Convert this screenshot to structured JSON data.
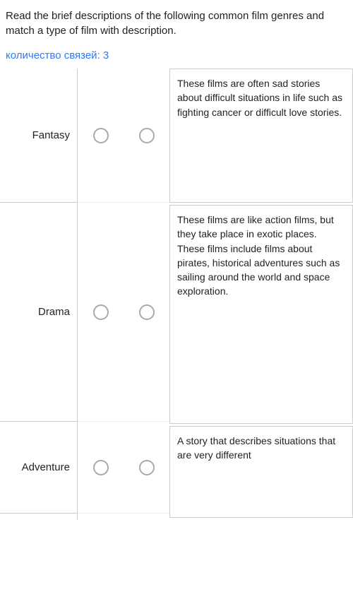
{
  "instructions": {
    "text": "Read the brief descriptions of the following common film genres and match a type of film with description."
  },
  "connections": {
    "label": "количество связей:",
    "count": "3"
  },
  "genres": [
    {
      "id": "fantasy",
      "label": "Fantasy"
    },
    {
      "id": "drama",
      "label": "Drama"
    },
    {
      "id": "adventure",
      "label": "Adventure"
    }
  ],
  "descriptions": [
    {
      "id": "desc1",
      "text": "These films are often sad stories about difficult situations in life such as fighting cancer or difficult love stories."
    },
    {
      "id": "desc2",
      "text": "These films are like action films, but they take place in exotic places. These films include films about pirates, historical adventures such as sailing around the world and space exploration."
    },
    {
      "id": "desc3",
      "text": "A story that describes situations that are very different"
    }
  ],
  "radio_pairs": [
    {
      "left_selected": false,
      "right_selected": false
    },
    {
      "left_selected": false,
      "right_selected": false
    },
    {
      "left_selected": false,
      "right_selected": false
    }
  ]
}
